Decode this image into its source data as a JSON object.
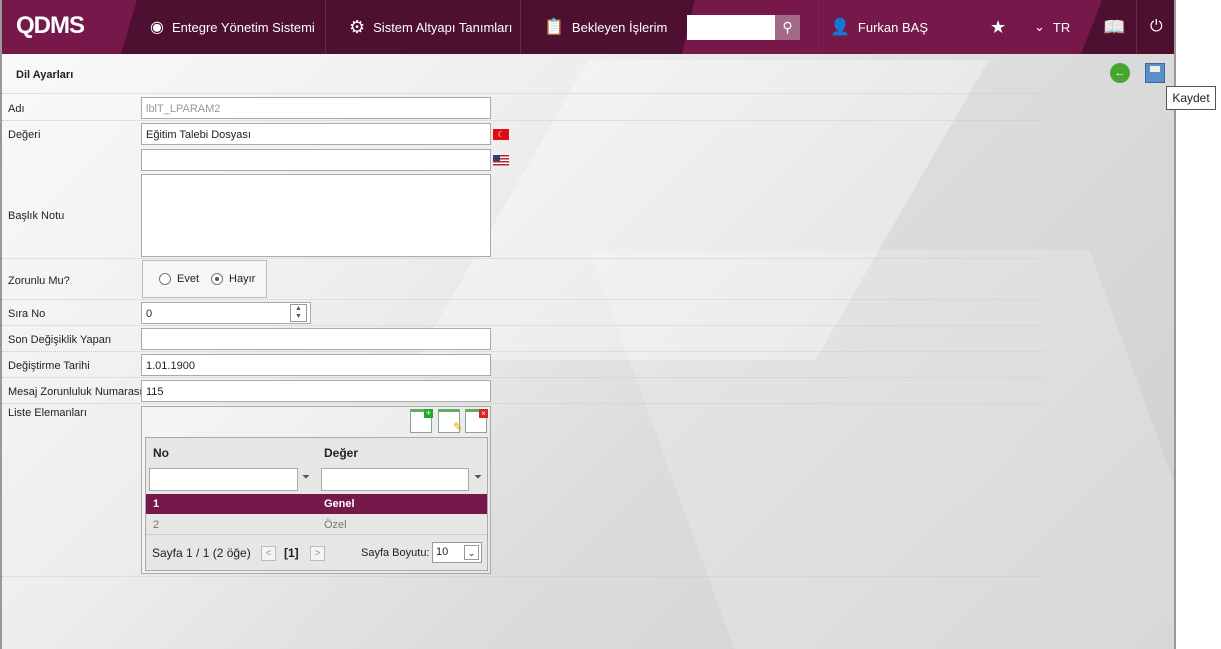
{
  "header": {
    "logo": "QDMS",
    "nav": [
      "Entegre Yönetim Sistemi",
      "Sistem Altyapı Tanımları",
      "Bekleyen İşlerim"
    ],
    "search_value": "",
    "user": "Furkan BAŞ",
    "language": "TR"
  },
  "page": {
    "title": "Dil Ayarları",
    "tooltip": "Kaydet"
  },
  "form": {
    "adi_label": "Adı",
    "adi_value": "lblT_LPARAM2",
    "degeri_label": "Değeri",
    "degeri_tr": "Eğitim Talebi Dosyası",
    "degeri_en": "",
    "baslik_label": "Başlık Notu",
    "baslik_value": "",
    "zorunlu_label": "Zorunlu Mu?",
    "evet": "Evet",
    "hayir": "Hayır",
    "zorunlu_selected": "Hayır",
    "sira_label": "Sıra No",
    "sira_value": "0",
    "son_label": "Son Değişiklik Yapan",
    "son_value": "",
    "tarih_label": "Değiştirme Tarihi",
    "tarih_value": "1.01.1900",
    "mesaj_label": "Mesaj Zorunluluk Numarası",
    "mesaj_value": "115",
    "liste_label": "Liste Elemanları"
  },
  "grid": {
    "columns": [
      "No",
      "Değer"
    ],
    "rows": [
      {
        "no": "1",
        "deger": "Genel"
      },
      {
        "no": "2",
        "deger": "Özel"
      }
    ],
    "pager": "Sayfa 1 / 1 (2 öğe)",
    "current_page": "[1]",
    "page_size_label": "Sayfa Boyutu:",
    "page_size": "10"
  },
  "colors": {
    "primary": "#76184a",
    "dark": "#4e1030"
  }
}
